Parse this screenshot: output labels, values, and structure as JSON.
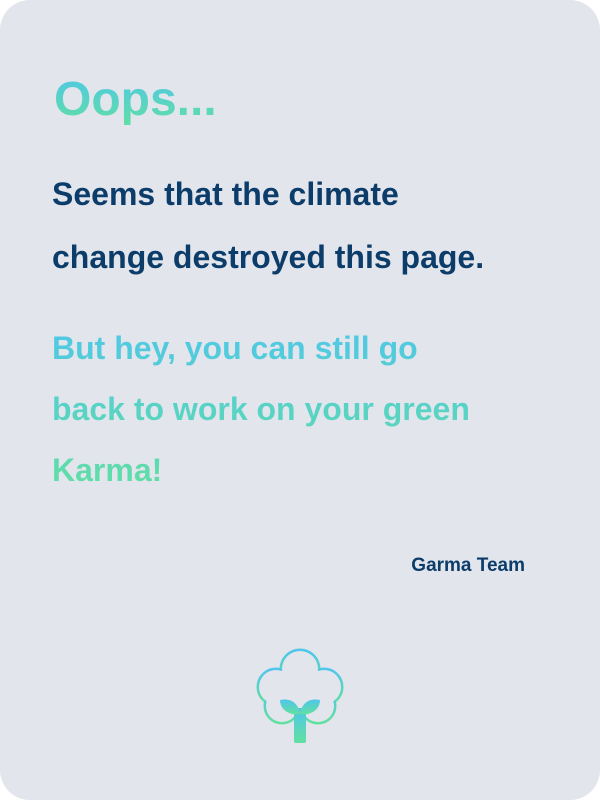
{
  "title": "Oops...",
  "message": [
    "Seems that the climate",
    "change destroyed this page."
  ],
  "subtext": [
    "But hey, you can still go",
    "back to work on your green",
    "Karma!"
  ],
  "signature": "Garma Team",
  "logo": {
    "icon": "cotton-sprout-icon",
    "colors": [
      "#4fc6ea",
      "#62e0a0"
    ]
  },
  "colors": {
    "background": "#e2e5ec",
    "text_dark": "#0c3c69",
    "gradient_top": "#4fc6ea",
    "gradient_bottom": "#62e0a0"
  }
}
